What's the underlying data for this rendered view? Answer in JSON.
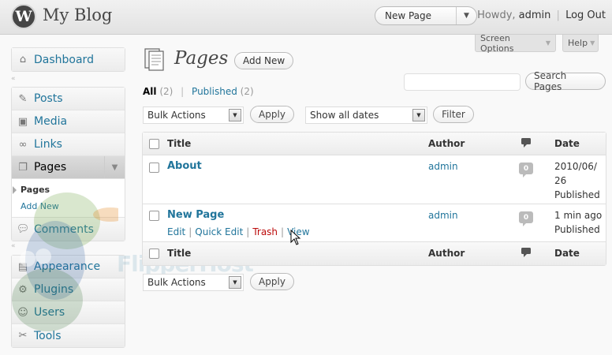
{
  "header": {
    "site_title": "My Blog",
    "favorite_action": "New Page",
    "howdy": "Howdy,",
    "username": "admin",
    "logout": "Log Out"
  },
  "screen_tabs": {
    "screen_options": "Screen Options",
    "help": "Help"
  },
  "menu": {
    "dashboard": "Dashboard",
    "posts": "Posts",
    "media": "Media",
    "links": "Links",
    "pages": "Pages",
    "pages_submenu": [
      "Pages",
      "Add New"
    ],
    "comments": "Comments",
    "appearance": "Appearance",
    "plugins": "Plugins",
    "users": "Users",
    "tools": "Tools"
  },
  "main": {
    "heading": "Pages",
    "add_new": "Add New",
    "filters": {
      "all_label": "All",
      "all_count": "(2)",
      "published_label": "Published",
      "published_count": "(2)"
    },
    "search_button": "Search Pages",
    "search_value": "",
    "bulk_actions": "Bulk Actions",
    "apply": "Apply",
    "dates_filter": "Show all dates",
    "filter_button": "Filter"
  },
  "table": {
    "columns": [
      "Title",
      "Author",
      "Date"
    ],
    "rows": [
      {
        "title": "About",
        "author": "admin",
        "comments": "0",
        "date_line1": "2010/06/",
        "date_line2": "26",
        "status": "Published"
      },
      {
        "title": "New Page",
        "author": "admin",
        "comments": "0",
        "date_line1": "1 min ago",
        "status": "Published",
        "actions": [
          "Edit",
          "Quick Edit",
          "Trash",
          "View"
        ]
      }
    ]
  },
  "watermark": "FlipperHost",
  "colors": {
    "link": "#21759b",
    "trash": "#bc0b0b",
    "header_bg": "#e4e4e4"
  }
}
